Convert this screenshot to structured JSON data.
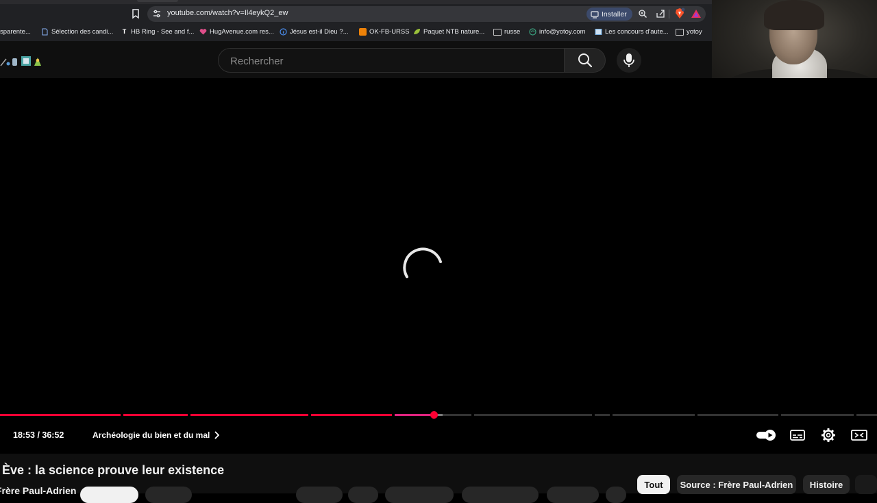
{
  "browser": {
    "url": "youtube.com/watch?v=Il4eykQ2_ew",
    "install_label": "Installer",
    "bookmarks": [
      {
        "label": "sparente...",
        "icon": "none"
      },
      {
        "label": "Sélection des candi...",
        "icon": "document-icon"
      },
      {
        "label": "HB Ring - See and f...",
        "icon": "t-icon"
      },
      {
        "label": "HugAvenue.com res...",
        "icon": "heart-icon"
      },
      {
        "label": "Jésus est-il Dieu ?...",
        "icon": "info-icon"
      },
      {
        "label": "OK-FB-URSS",
        "icon": "ok-icon"
      },
      {
        "label": "Paquet NTB nature...",
        "icon": "leaf-icon"
      },
      {
        "label": "russe",
        "icon": "folder-icon"
      },
      {
        "label": "info@yotoy.com",
        "icon": "globe-icon"
      },
      {
        "label": "Les concours d'aute...",
        "icon": "image-icon"
      },
      {
        "label": "yotoy",
        "icon": "folder-icon"
      }
    ]
  },
  "header": {
    "search_placeholder": "Rechercher"
  },
  "player": {
    "time": "18:53 / 36:52",
    "chapter": "Archéologie du bien et du mal",
    "played_fraction": 0.495,
    "state": "loading"
  },
  "video": {
    "title": "Ève : la science prouve leur existence",
    "channel": "Frère Paul-Adrien"
  },
  "chips": [
    "Tout",
    "Source : Frère Paul-Adrien",
    "Histoire"
  ],
  "colors": {
    "accent": "#ff0033",
    "background": "#0f0f0f",
    "chrome": "#202124"
  }
}
